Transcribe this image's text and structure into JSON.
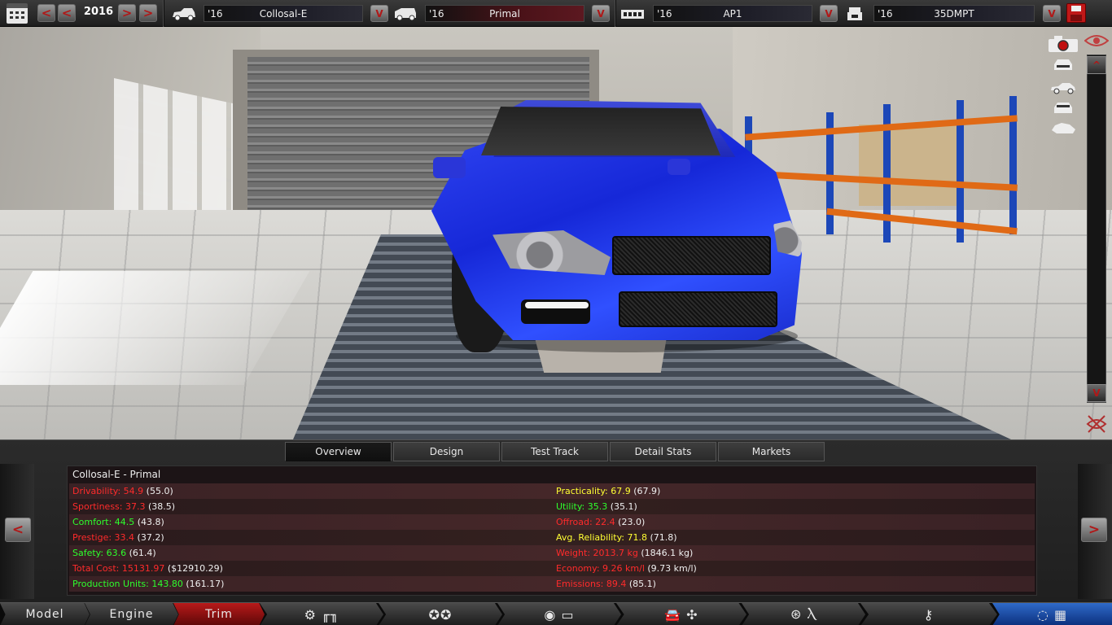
{
  "topbar": {
    "year": "2016",
    "prev_fast": "<",
    "prev": "<",
    "next": ">",
    "next_fast": ">",
    "dropdown_arrow": "V",
    "selectors": [
      {
        "id": "model",
        "icon": "car-body-icon",
        "year": "'16",
        "name": "Collosal-E"
      },
      {
        "id": "trim",
        "icon": "car-trim-icon",
        "year": "'16",
        "name": "Primal"
      },
      {
        "id": "engine",
        "icon": "engine-block-icon",
        "year": "'16",
        "name": "AP1"
      },
      {
        "id": "variant",
        "icon": "engine-variant-icon",
        "year": "'16",
        "name": "35DMPT"
      }
    ]
  },
  "scene": {
    "scroll_up": "^",
    "scroll_down": "V",
    "camera_icon": "camera-record-icon",
    "eye_icon": "eye-icon",
    "view_icons": [
      "car-front-view-icon",
      "car-side-view-icon",
      "car-rear-view-icon",
      "car-angle-view-icon"
    ],
    "hide_icon": "hide-panel-icon",
    "car_color": "#1f2fe0"
  },
  "tabs": [
    "Overview",
    "Design",
    "Test Track",
    "Detail Stats",
    "Markets"
  ],
  "active_tab": "Overview",
  "panel": {
    "prev_label": "<",
    "next_label": ">",
    "title": "Collosal-E - Primal",
    "left_stats": [
      {
        "label": "Drivability:",
        "value": "54.9",
        "prev": "(55.0)",
        "color": "red"
      },
      {
        "label": "Sportiness:",
        "value": "37.3",
        "prev": "(38.5)",
        "color": "red"
      },
      {
        "label": "Comfort:",
        "value": "44.5",
        "prev": "(43.8)",
        "color": "green"
      },
      {
        "label": "Prestige:",
        "value": "33.4",
        "prev": "(37.2)",
        "color": "red"
      },
      {
        "label": "Safety:",
        "value": "63.6",
        "prev": "(61.4)",
        "color": "green"
      },
      {
        "label": "Total Cost:",
        "value": "15131.97",
        "prev": "($12910.29)",
        "color": "red"
      },
      {
        "label": "Production Units:",
        "value": "143.80",
        "prev": "(161.17)",
        "color": "green"
      }
    ],
    "right_stats": [
      {
        "label": "Practicality:",
        "value": "67.9",
        "prev": "(67.9)",
        "color": "yellow"
      },
      {
        "label": "Utility:",
        "value": "35.3",
        "prev": "(35.1)",
        "color": "green"
      },
      {
        "label": "Offroad:",
        "value": "22.4",
        "prev": "(23.0)",
        "color": "red"
      },
      {
        "label": "Avg. Reliability:",
        "value": "71.8",
        "prev": "(71.8)",
        "color": "yellow"
      },
      {
        "label": "Weight:",
        "value": "2013.7 kg",
        "prev": "(1846.1 kg)",
        "color": "red"
      },
      {
        "label": "Economy:",
        "value": "9.26 km/l",
        "prev": "(9.73 km/l)",
        "color": "red"
      },
      {
        "label": "Emissions:",
        "value": "89.4",
        "prev": "(85.1)",
        "color": "red"
      }
    ]
  },
  "nav": {
    "model": "Model",
    "engine": "Engine",
    "trim": "Trim",
    "active": "Trim",
    "icons": [
      "gear-transmission-icon",
      "wheels-icon",
      "brakes-suspension-icon",
      "aero-cooling-icon",
      "interior-seat-icon",
      "fuel-injector-icon",
      "test-finish-icon"
    ]
  }
}
